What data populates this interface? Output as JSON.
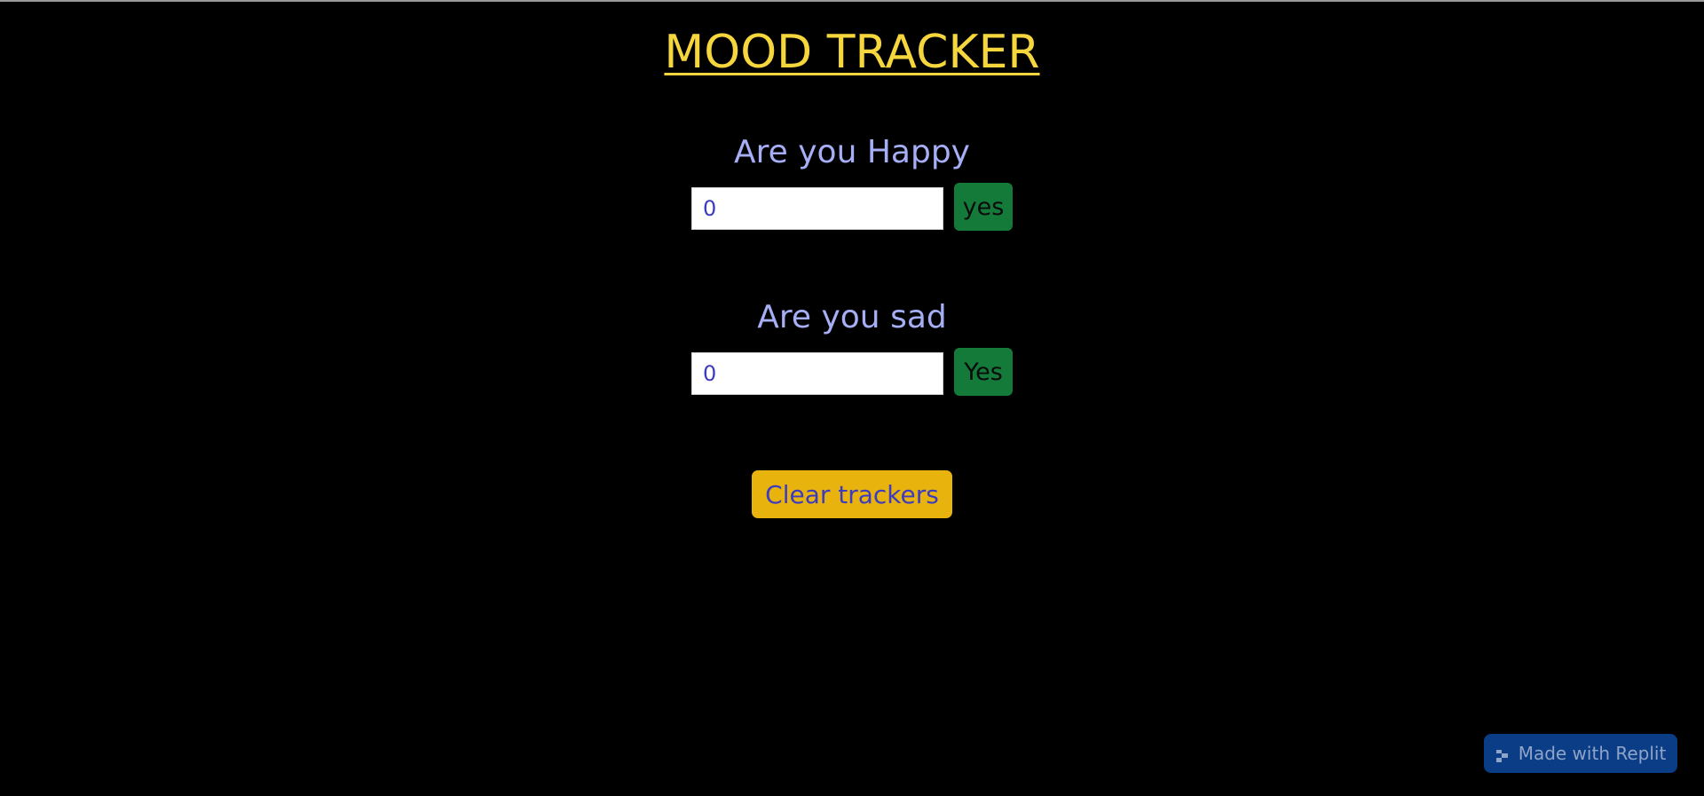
{
  "app": {
    "title": "MOOD TRACKER"
  },
  "trackers": [
    {
      "question": "Are you Happy",
      "count": "0",
      "button_label": "yes"
    },
    {
      "question": "Are you sad",
      "count": "0",
      "button_label": "Yes"
    }
  ],
  "actions": {
    "clear_label": "Clear trackers"
  },
  "badge": {
    "label": "Made with Replit",
    "icon": "replit-icon"
  },
  "colors": {
    "background": "#000000",
    "title": "#f5d63d",
    "question": "#a6aef5",
    "yes_button": "#147a3a",
    "clear_button": "#e8b30c",
    "counter_text": "#3d3cc0",
    "badge_bg": "#0b3d86"
  }
}
